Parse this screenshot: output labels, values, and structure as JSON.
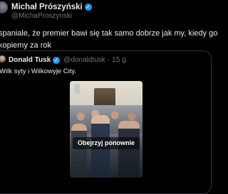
{
  "post": {
    "author_name": "Michał Prószyński",
    "author_handle": "@MichaProszynski",
    "text_lines": [
      "spaniale, że premier bawi się tak samo dobrze jak my, kiedy go",
      "kopiemy za rok"
    ]
  },
  "quoted": {
    "author_name": "Donald Tusk",
    "author_handle": "@donaldtusk",
    "separator": "·",
    "time": "15 g.",
    "text": "Wilk syty i Wilkowyje City.",
    "video": {
      "replay_label": "Obejrzyj ponownie"
    }
  },
  "icons": {
    "verified": "verified-badge-icon"
  },
  "colors": {
    "background": "#000000",
    "text": "#e7e9ea",
    "secondary": "#71767b",
    "verified": "#1d9bf0",
    "border": "#2f3336"
  }
}
